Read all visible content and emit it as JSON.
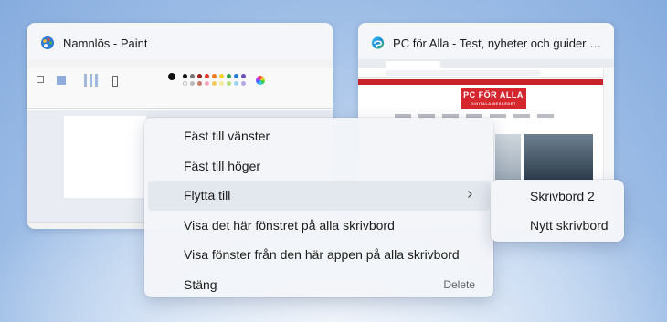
{
  "windows": [
    {
      "title": "Namnlös - Paint",
      "icon": "paint-palette-icon"
    },
    {
      "title": "PC för Alla - Test, nyheter och guider krin...",
      "icon": "edge-browser-icon",
      "site_logo": "PC FÖR ALLA",
      "site_logo_sub": "DIGITALA BESKEDET"
    }
  ],
  "context_menu": {
    "items": [
      {
        "label": "Fäst till vänster"
      },
      {
        "label": "Fäst till höger"
      },
      {
        "label": "Flytta till",
        "has_submenu": true
      },
      {
        "label": "Visa det här fönstret på alla skrivbord"
      },
      {
        "label": "Visa fönster från den här appen på alla skrivbord"
      },
      {
        "label": "Stäng",
        "shortcut": "Delete"
      }
    ]
  },
  "submenu": {
    "items": [
      {
        "label": "Skrivbord 2"
      },
      {
        "label": "Nytt skrivbord"
      }
    ]
  },
  "colors": {
    "accent_red": "#c8222a",
    "menu_bg": "#f3f5f9",
    "hover_bg": "#e3e7ee"
  }
}
